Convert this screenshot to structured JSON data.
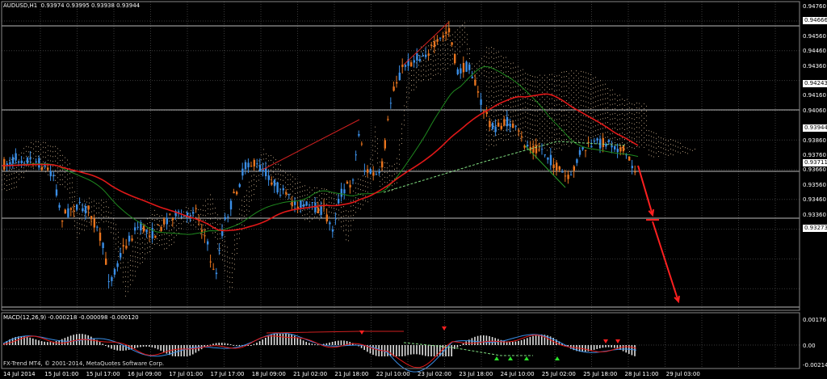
{
  "header": {
    "symbol": "AUDUSD,H1",
    "ohlc": "0.93974 0.93995 0.93938 0.93944"
  },
  "indicator": {
    "title": "MACD(12,26,9) -0.000218 -0.000098 -0.000120"
  },
  "copyright": "FX-Trend MT4, © 2001-2014, MetaQuotes Software Corp.",
  "price_axis": [
    {
      "text": "0.94760",
      "box": false
    },
    {
      "text": "0.94666",
      "box": true
    },
    {
      "text": "0.94560",
      "box": false
    },
    {
      "text": "0.94460",
      "box": false
    },
    {
      "text": "0.94360",
      "box": false
    },
    {
      "text": "0.94243",
      "box": true
    },
    {
      "text": "0.94160",
      "box": false
    },
    {
      "text": "0.94060",
      "box": false
    },
    {
      "text": "0.93944",
      "box": true
    },
    {
      "text": "0.93860",
      "box": false
    },
    {
      "text": "0.93760",
      "box": false
    },
    {
      "text": "0.93711",
      "box": true
    },
    {
      "text": "0.93660",
      "box": false
    },
    {
      "text": "0.93560",
      "box": false
    },
    {
      "text": "0.93460",
      "box": false
    },
    {
      "text": "0.93360",
      "box": false
    },
    {
      "text": "0.93273",
      "box": true
    }
  ],
  "macd_axis": [
    "0.00176",
    "0.00",
    "-0.00214"
  ],
  "time_axis": [
    "14 Jul 2014",
    "15 Jul 01:00",
    "15 Jul 17:00",
    "16 Jul 09:00",
    "17 Jul 01:00",
    "17 Jul 17:00",
    "18 Jul 09:00",
    "21 Jul 02:00",
    "21 Jul 18:00",
    "22 Jul 10:00",
    "23 Jul 02:00",
    "23 Jul 18:00",
    "24 Jul 10:00",
    "25 Jul 02:00",
    "25 Jul 18:00",
    "28 Jul 11:00",
    "29 Jul 03:00"
  ],
  "colors": {
    "background": "#000000",
    "grid": "#3a3a3a",
    "bull": "#3a8ee6",
    "bear": "#e8741e",
    "ma_fast": "#e01818",
    "ma_slow": "#1f8a1f",
    "cloud": "#e8c8a0",
    "arrow": "#ff2020"
  }
}
